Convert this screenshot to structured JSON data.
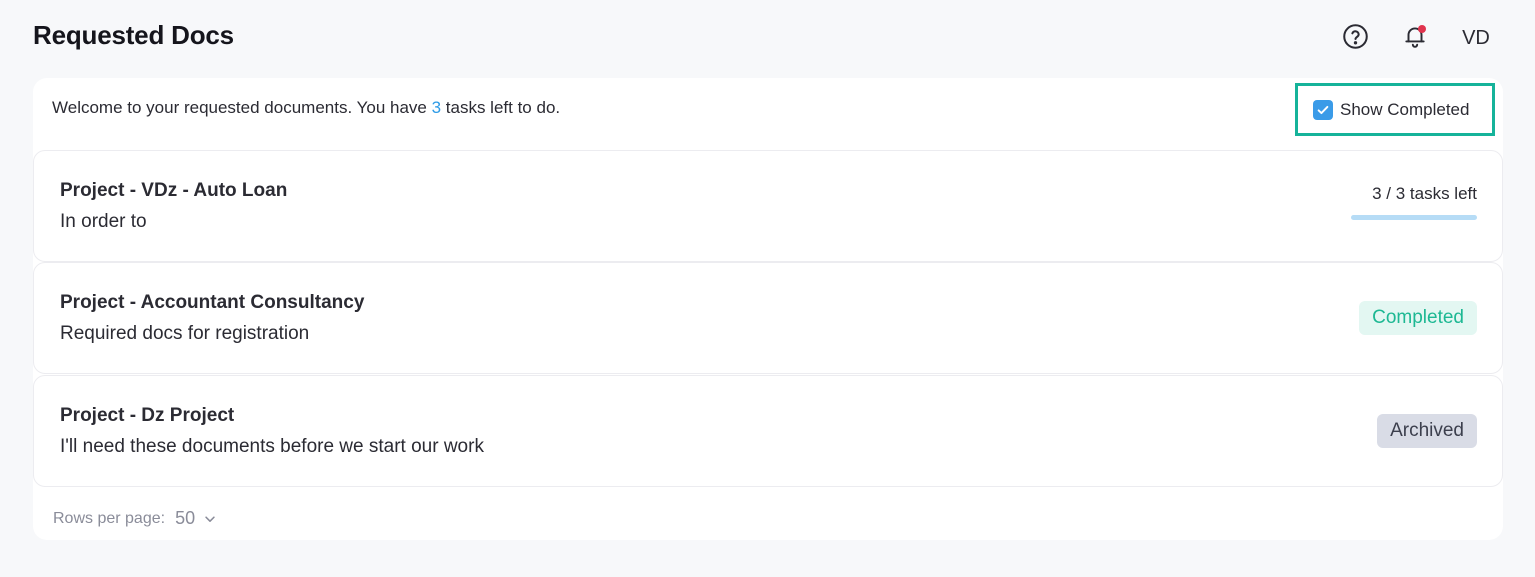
{
  "header": {
    "title": "Requested Docs",
    "avatar_initials": "VD",
    "icons": {
      "help": "help-circle-icon",
      "notifications": "bell-icon"
    },
    "notification_dot_color": "#e0334d"
  },
  "welcome": {
    "prefix": "Welcome to your requested documents. You have ",
    "task_count": "3",
    "suffix": " tasks left to do."
  },
  "filters": {
    "show_completed_label": "Show Completed",
    "show_completed_checked": true
  },
  "requests": [
    {
      "title": "Project - VDz - Auto Loan",
      "description": "In order to",
      "status_type": "progress",
      "tasks_text": "3 / 3 tasks left",
      "progress_fraction": 1.0
    },
    {
      "title": "Project - Accountant Consultancy",
      "description": "Required docs for registration",
      "status_type": "badge",
      "badge": "Completed"
    },
    {
      "title": "Project - Dz Project",
      "description": "I'll need these documents before we start our work",
      "status_type": "badge",
      "badge": "Archived"
    }
  ],
  "pagination": {
    "rows_per_page_label": "Rows per page:",
    "rows_per_page_value": "50"
  },
  "colors": {
    "accent_blue": "#2e9be6",
    "highlight_border": "#15b39a",
    "completed_text": "#1db893",
    "completed_bg": "#e3f7f2",
    "archived_bg": "#d9dce6"
  }
}
